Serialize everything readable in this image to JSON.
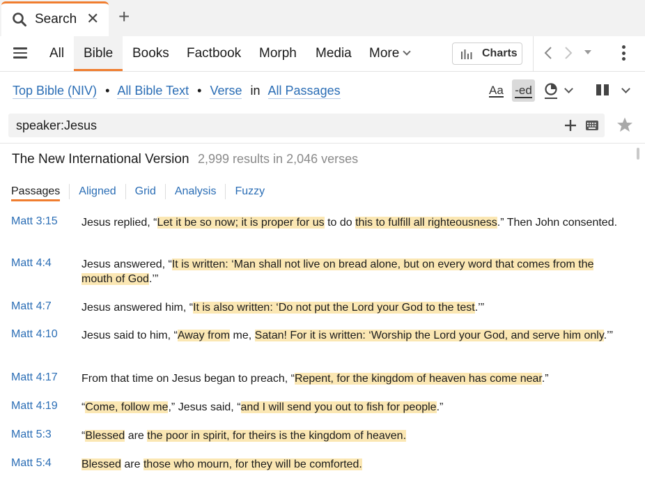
{
  "tab": {
    "title": "Search",
    "close": "✕",
    "new_tab": "+"
  },
  "nav": {
    "items": [
      "All",
      "Bible",
      "Books",
      "Factbook",
      "Morph",
      "Media"
    ],
    "active": "Bible",
    "more_label": "More",
    "charts_label": "Charts"
  },
  "scope": {
    "bible": "Top Bible (NIV)",
    "text": "All Bible Text",
    "unit": "Verse",
    "in_word": "in",
    "range": "All Passages",
    "bullet": "•"
  },
  "tools": {
    "font_label": "Aa",
    "ed_label": "-ed"
  },
  "search": {
    "query": "speaker:Jesus",
    "placeholder": ""
  },
  "results": {
    "version": "The New International Version",
    "count_text": "2,999 results in 2,046 verses"
  },
  "view_tabs": [
    "Passages",
    "Aligned",
    "Grid",
    "Analysis",
    "Fuzzy"
  ],
  "verses": [
    {
      "ref": "Matt 3:15",
      "segments": [
        {
          "t": "Jesus replied, “"
        },
        {
          "t": "Let it be so now; it is proper for us",
          "h": true
        },
        {
          "t": " to do "
        },
        {
          "t": "this to fulfill all righteousness",
          "h": true
        },
        {
          "t": ".” Then John consented."
        }
      ]
    },
    {
      "ref": "Matt 4:4",
      "segments": [
        {
          "t": "Jesus answered, “"
        },
        {
          "t": "It is written: ‘Man shall not live on bread alone, but on every word that comes from the mouth of God",
          "h": true
        },
        {
          "t": ".’”"
        }
      ]
    },
    {
      "ref": "Matt 4:7",
      "segments": [
        {
          "t": "Jesus answered him, “"
        },
        {
          "t": "It is also written: ‘Do not put the Lord your God to the test",
          "h": true
        },
        {
          "t": ".’”"
        }
      ]
    },
    {
      "ref": "Matt 4:10",
      "segments": [
        {
          "t": "Jesus said to him, “"
        },
        {
          "t": "Away from",
          "h": true
        },
        {
          "t": " me, "
        },
        {
          "t": "Satan! For it is written: ‘Worship the Lord your God, and serve him only",
          "h": true
        },
        {
          "t": ".’”"
        }
      ]
    },
    {
      "ref": "Matt 4:17",
      "segments": [
        {
          "t": "From that time on Jesus began to preach, “"
        },
        {
          "t": "Repent, for the kingdom of heaven has come near",
          "h": true
        },
        {
          "t": ".”"
        }
      ]
    },
    {
      "ref": "Matt 4:19",
      "segments": [
        {
          "t": "“"
        },
        {
          "t": "Come, follow me",
          "h": true
        },
        {
          "t": ",” Jesus said, “"
        },
        {
          "t": "and I will send you out to fish for people",
          "h": true
        },
        {
          "t": ".”"
        }
      ]
    },
    {
      "ref": "Matt 5:3",
      "segments": [
        {
          "t": "“"
        },
        {
          "t": "Blessed",
          "h": true
        },
        {
          "t": " are "
        },
        {
          "t": "the poor in spirit, for theirs is the kingdom of heaven.",
          "h": true
        }
      ]
    },
    {
      "ref": "Matt 5:4",
      "segments": [
        {
          "t": "Blessed",
          "h": true
        },
        {
          "t": " are "
        },
        {
          "t": "those who mourn, for they will be comforted.",
          "h": true
        }
      ]
    }
  ],
  "colors": {
    "accent": "#f07d2f",
    "link": "#2a6db5",
    "highlight": "#fbe7b3"
  },
  "icons": [
    "search-icon",
    "close-icon",
    "plus-icon",
    "hamburger-icon",
    "chevron-down-icon",
    "charts-icon",
    "back-arrow-icon",
    "forward-arrow-icon",
    "kebab-icon",
    "font-icon",
    "ed-icon",
    "ring-icon",
    "split-view-icon",
    "keyboard-icon",
    "star-icon"
  ]
}
